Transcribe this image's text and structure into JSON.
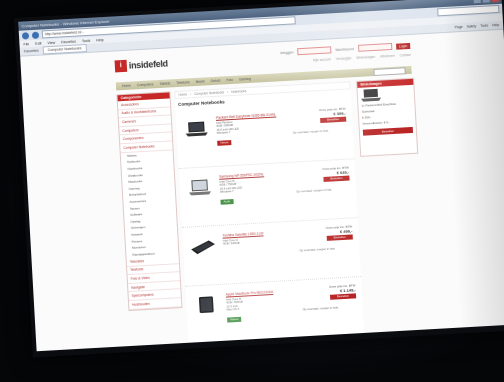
{
  "browser": {
    "title": "Computer Notebooks - Windows Internet Explorer",
    "url": "http://www.insidefeld.nl/...",
    "menu": [
      "File",
      "Edit",
      "View",
      "Favorites",
      "Tools",
      "Help"
    ],
    "favorites_label": "Favorites",
    "tab_label": "Computer Notebooks",
    "commands": [
      "Page",
      "Safety",
      "Tools",
      "Help"
    ]
  },
  "site": {
    "logo_text": "insidefeld",
    "top_links": [
      "Inloggen",
      "Wachtwoord"
    ],
    "login_button": "Login",
    "sub_links": [
      "Mijn account",
      "Verlanglijst",
      "Winkelwagen",
      "Afrekenen",
      "Contact"
    ],
    "nav": [
      "Home",
      "Computers",
      "Tablets",
      "Telefonie",
      "Beeld",
      "Geluid",
      "Foto",
      "Gaming"
    ]
  },
  "sidebar": {
    "header": "Categorieën",
    "items": [
      "Accessoires",
      "Audio & Hoofdtelefoons",
      "Camera's",
      "Computers",
      "Componenten",
      "Computer Notebooks"
    ],
    "sub_items": [
      "Tablets",
      "Netbooks",
      "Notebooks",
      "Ultrabooks",
      "Macbooks",
      "Gaming",
      "Refurbished",
      "Accessoires",
      "Tassen",
      "Software",
      "Opslag",
      "Geheugen",
      "Netwerk",
      "Printers",
      "Monitoren",
      "Randapparatuur"
    ],
    "more_items": [
      "Televisies",
      "Telefonie",
      "Foto & Video",
      "Navigatie",
      "Spelcomputers",
      "Huishouden"
    ]
  },
  "main": {
    "breadcrumb": [
      "Home",
      "Computer Notebooks",
      "Notebooks"
    ],
    "title": "Computer Notebooks",
    "products": [
      {
        "name": "Packard Bell EasyNote NJ65-BB-014NL",
        "specs": [
          "Intel Pentium",
          "4GB / 500GB",
          "15.6 inch HD LED",
          "Windows 7"
        ],
        "tag": "Nieuw",
        "tag_color": "red",
        "price_label": "Onze prijs inc. BTW",
        "price": "€ 399,-",
        "buy": "Bestellen",
        "stock": "Op voorraad, morgen in huis",
        "image": "laptop-icon"
      },
      {
        "name": "Samsung NP-550P5C-S02NL",
        "specs": [
          "Intel Core i5",
          "6GB / 750GB",
          "15.6 inch HD LED",
          "Windows 7"
        ],
        "tag": "Actie",
        "tag_color": "green",
        "price_label": "Onze prijs inc. BTW",
        "price": "€ 649,-",
        "buy": "Bestellen",
        "stock": "Op voorraad, morgen in huis",
        "image": "laptop-icon"
      },
      {
        "name": "Toshiba Satellite L850-1LW",
        "specs": [
          "Intel Core i3",
          "4GB / 640GB"
        ],
        "tag": "",
        "tag_color": "red",
        "price_label": "Onze prijs inc. BTW",
        "price": "€ 499,-",
        "buy": "Bestellen",
        "stock": "Op voorraad, morgen in huis",
        "image": "tablet-icon"
      },
      {
        "name": "Apple MacBook Pro MD101N/A",
        "specs": [
          "Intel Core i5",
          "4GB / 500GB",
          "13.3 inch",
          "Mac OS X"
        ],
        "tag": "Nieuw",
        "tag_color": "green",
        "price_label": "Onze prijs inc. BTW",
        "price": "€ 1.149,-",
        "buy": "Bestellen",
        "stock": "Op voorraad, morgen in huis",
        "image": "tablet-icon"
      }
    ]
  },
  "cart": {
    "header": "Winkelwagen",
    "lines": [
      "1x Packard Bell EasyNote",
      "Subtotaal",
      "€ 399,-",
      "Verzendkosten: € 0,-"
    ],
    "checkout": "Bestellen"
  },
  "colors": {
    "brand": "#c62828",
    "nav": "#c4c29e",
    "page_bg": "#fbfbfb"
  }
}
